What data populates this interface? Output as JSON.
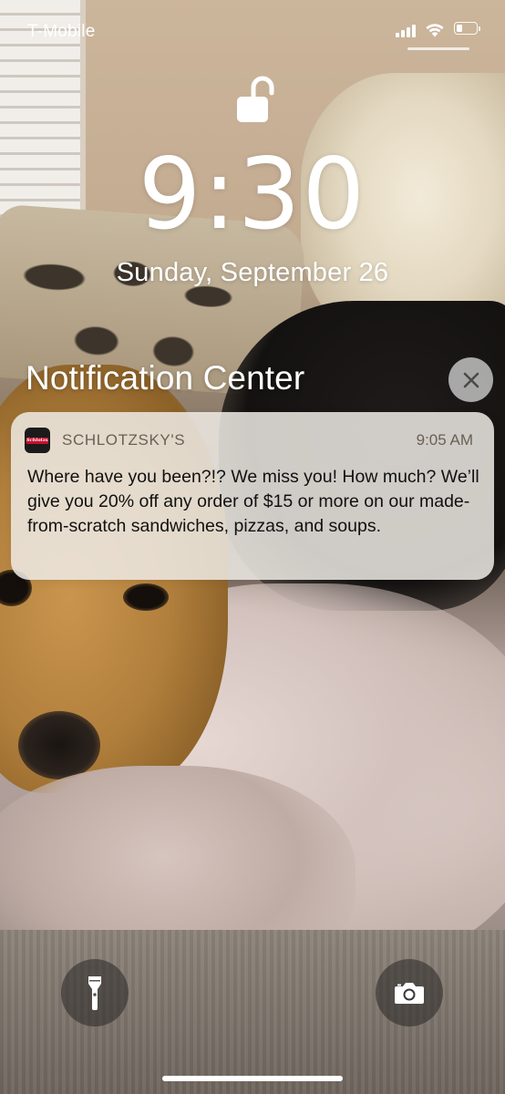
{
  "status_bar": {
    "carrier": "T-Mobile",
    "signal_bars": 4,
    "wifi": "wifi-icon",
    "battery_level_fraction": 0.3
  },
  "lock_screen": {
    "lock_state": "unlocked",
    "time": "9:30",
    "date": "Sunday, September 26"
  },
  "notification_center": {
    "title": "Notification Center",
    "close_icon": "close-icon",
    "notifications": [
      {
        "app_name": "SCHLOTZSKY'S",
        "app_icon_text": "Schlotzsky's",
        "time": "9:05 AM",
        "body": "Where have you been?!? We miss you! How much? We’ll give you 20% off any order of $15 or more on our made-from-scratch sandwiches, pizzas, and soups."
      }
    ]
  },
  "quick_actions": {
    "left": "flashlight-icon",
    "right": "camera-icon"
  },
  "colors": {
    "notification_bg": "#eeeae4",
    "app_text": "#6b6055",
    "brand_red": "#c8102e"
  }
}
